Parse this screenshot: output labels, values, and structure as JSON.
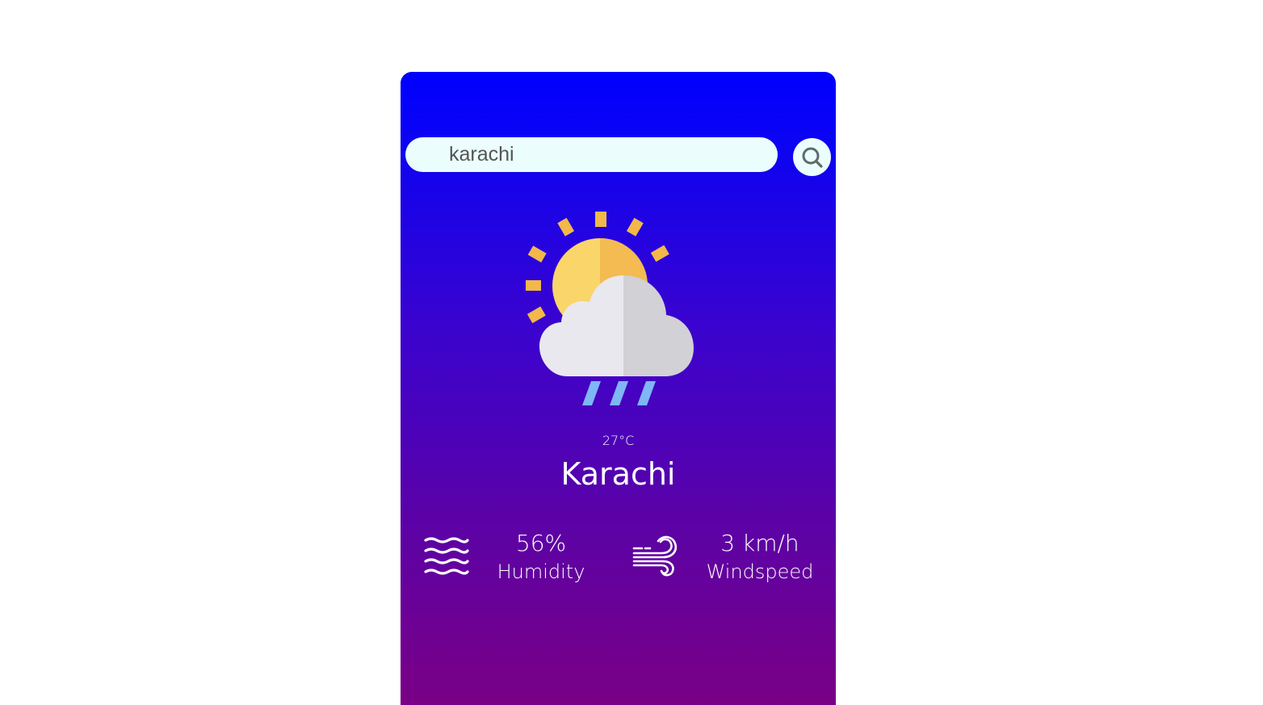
{
  "search": {
    "value": "karachi"
  },
  "weather": {
    "icon": "sun-cloud-rain-icon",
    "temperature": "27°C",
    "city": "Karachi"
  },
  "details": {
    "humidity": {
      "icon": "humidity-waves-icon",
      "value": "56%",
      "label": "Humidity"
    },
    "wind": {
      "icon": "wind-icon",
      "value": "3 km/h",
      "label": "Windspeed"
    }
  },
  "colors": {
    "gradient_top": "#0000ff",
    "gradient_bottom": "#7a0085",
    "input_bg": "#ebfdfd",
    "sun": "#f9d56a",
    "sun_rays": "#f3b84a",
    "cloud_light": "#e9e8ee",
    "cloud_dark": "#d2d1d6",
    "rain": "#7fb6f5"
  }
}
